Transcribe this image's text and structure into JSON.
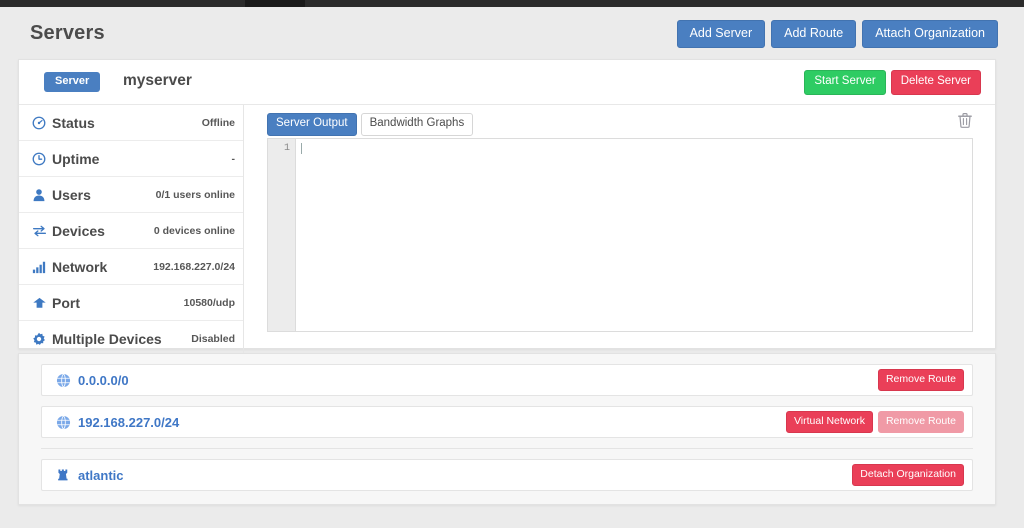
{
  "header": {
    "title": "Servers",
    "buttons": [
      {
        "label": "Add Server",
        "name": "add-server-button"
      },
      {
        "label": "Add Route",
        "name": "add-route-button"
      },
      {
        "label": "Attach Organization",
        "name": "attach-organization-button"
      }
    ]
  },
  "server_card": {
    "badge": "Server",
    "name": "myserver",
    "start_label": "Start Server",
    "delete_label": "Delete Server",
    "info": [
      {
        "icon": "dashboard-icon",
        "label": "Status",
        "value": "Offline"
      },
      {
        "icon": "clock-icon",
        "label": "Uptime",
        "value": "-"
      },
      {
        "icon": "user-icon",
        "label": "Users",
        "value": "0/1 users online"
      },
      {
        "icon": "exchange-icon",
        "label": "Devices",
        "value": "0 devices online"
      },
      {
        "icon": "signal-icon",
        "label": "Network",
        "value": "192.168.227.0/24"
      },
      {
        "icon": "upload-icon",
        "label": "Port",
        "value": "10580/udp"
      },
      {
        "icon": "gear-icon",
        "label": "Multiple Devices",
        "value": "Disabled"
      }
    ],
    "tabs": [
      {
        "label": "Server Output",
        "active": true
      },
      {
        "label": "Bandwidth Graphs",
        "active": false
      }
    ],
    "output": {
      "line_number": "1",
      "content": ""
    },
    "clear_icon": "trash-icon"
  },
  "routes": [
    {
      "icon": "globe-icon",
      "label": "0.0.0.0/0",
      "badge": "",
      "action": "Remove Route",
      "action_disabled": false
    },
    {
      "icon": "globe-icon",
      "label": "192.168.227.0/24",
      "badge": "Virtual Network",
      "action": "Remove Route",
      "action_disabled": true
    }
  ],
  "organizations": [
    {
      "icon": "rook-icon",
      "label": "atlantic",
      "action": "Detach Organization"
    }
  ],
  "colors": {
    "blue": "#4a7fc1",
    "green": "#2ecc63",
    "red": "#ea3f58",
    "red_faded": "#f09aa6",
    "link": "#3f77c6",
    "text": "#4b4b4b"
  }
}
